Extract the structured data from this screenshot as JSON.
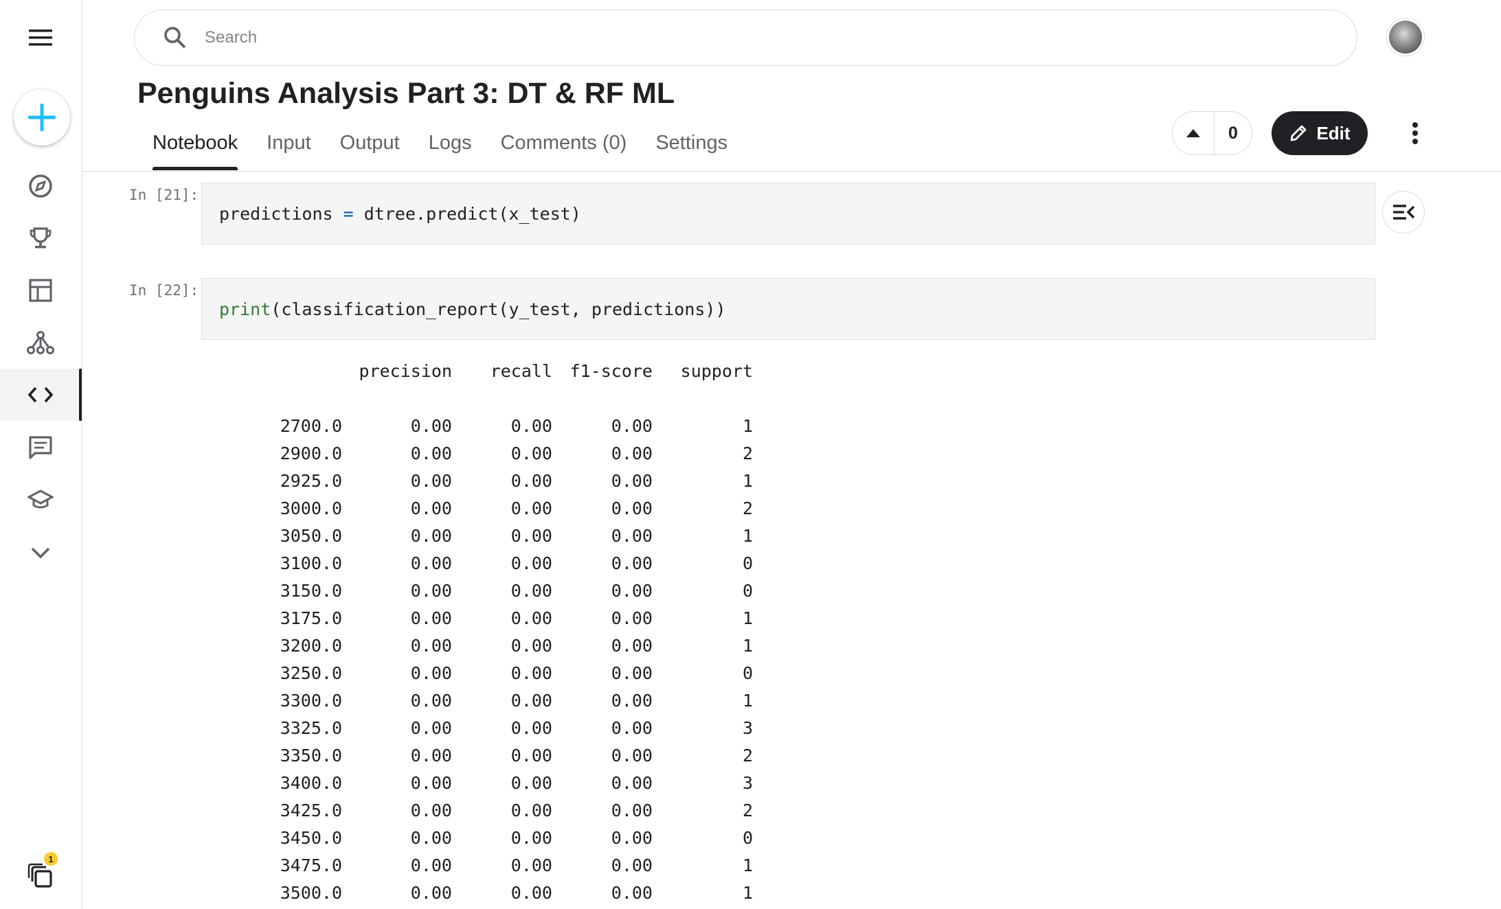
{
  "search": {
    "placeholder": "Search"
  },
  "notebook": {
    "title": "Penguins Analysis Part 3: DT & RF ML"
  },
  "tabs": [
    {
      "label": "Notebook",
      "active": true
    },
    {
      "label": "Input"
    },
    {
      "label": "Output"
    },
    {
      "label": "Logs"
    },
    {
      "label": "Comments (0)"
    },
    {
      "label": "Settings"
    }
  ],
  "actions": {
    "vote_count": "0",
    "edit_label": "Edit"
  },
  "sidebar": {
    "items": [
      {
        "icon": "menu-icon"
      },
      {
        "icon": "create-icon"
      },
      {
        "icon": "compass-icon"
      },
      {
        "icon": "trophy-icon"
      },
      {
        "icon": "table-icon"
      },
      {
        "icon": "models-icon"
      },
      {
        "icon": "code-icon",
        "active": true
      },
      {
        "icon": "discussion-icon"
      },
      {
        "icon": "learn-icon"
      },
      {
        "icon": "chevron-down-icon"
      }
    ],
    "badge_count": "1"
  },
  "cells": [
    {
      "prompt": "In [21]:",
      "code": {
        "var": "predictions",
        "op": "=",
        "rest": "dtree.predict(x_test)"
      }
    },
    {
      "prompt": "In [22]:",
      "code": {
        "fn": "print",
        "rest": "(classification_report(y_test, predictions))"
      }
    }
  ],
  "report": {
    "headers": [
      "",
      "precision",
      "recall",
      "f1-score",
      "support"
    ],
    "rows": [
      [
        "2700.0",
        "0.00",
        "0.00",
        "0.00",
        "1"
      ],
      [
        "2900.0",
        "0.00",
        "0.00",
        "0.00",
        "2"
      ],
      [
        "2925.0",
        "0.00",
        "0.00",
        "0.00",
        "1"
      ],
      [
        "3000.0",
        "0.00",
        "0.00",
        "0.00",
        "2"
      ],
      [
        "3050.0",
        "0.00",
        "0.00",
        "0.00",
        "1"
      ],
      [
        "3100.0",
        "0.00",
        "0.00",
        "0.00",
        "0"
      ],
      [
        "3150.0",
        "0.00",
        "0.00",
        "0.00",
        "0"
      ],
      [
        "3175.0",
        "0.00",
        "0.00",
        "0.00",
        "1"
      ],
      [
        "3200.0",
        "0.00",
        "0.00",
        "0.00",
        "1"
      ],
      [
        "3250.0",
        "0.00",
        "0.00",
        "0.00",
        "0"
      ],
      [
        "3300.0",
        "0.00",
        "0.00",
        "0.00",
        "1"
      ],
      [
        "3325.0",
        "0.00",
        "0.00",
        "0.00",
        "3"
      ],
      [
        "3350.0",
        "0.00",
        "0.00",
        "0.00",
        "2"
      ],
      [
        "3400.0",
        "0.00",
        "0.00",
        "0.00",
        "3"
      ],
      [
        "3425.0",
        "0.00",
        "0.00",
        "0.00",
        "2"
      ],
      [
        "3450.0",
        "0.00",
        "0.00",
        "0.00",
        "0"
      ],
      [
        "3475.0",
        "0.00",
        "0.00",
        "0.00",
        "1"
      ],
      [
        "3500.0",
        "0.00",
        "0.00",
        "0.00",
        "1"
      ]
    ]
  }
}
